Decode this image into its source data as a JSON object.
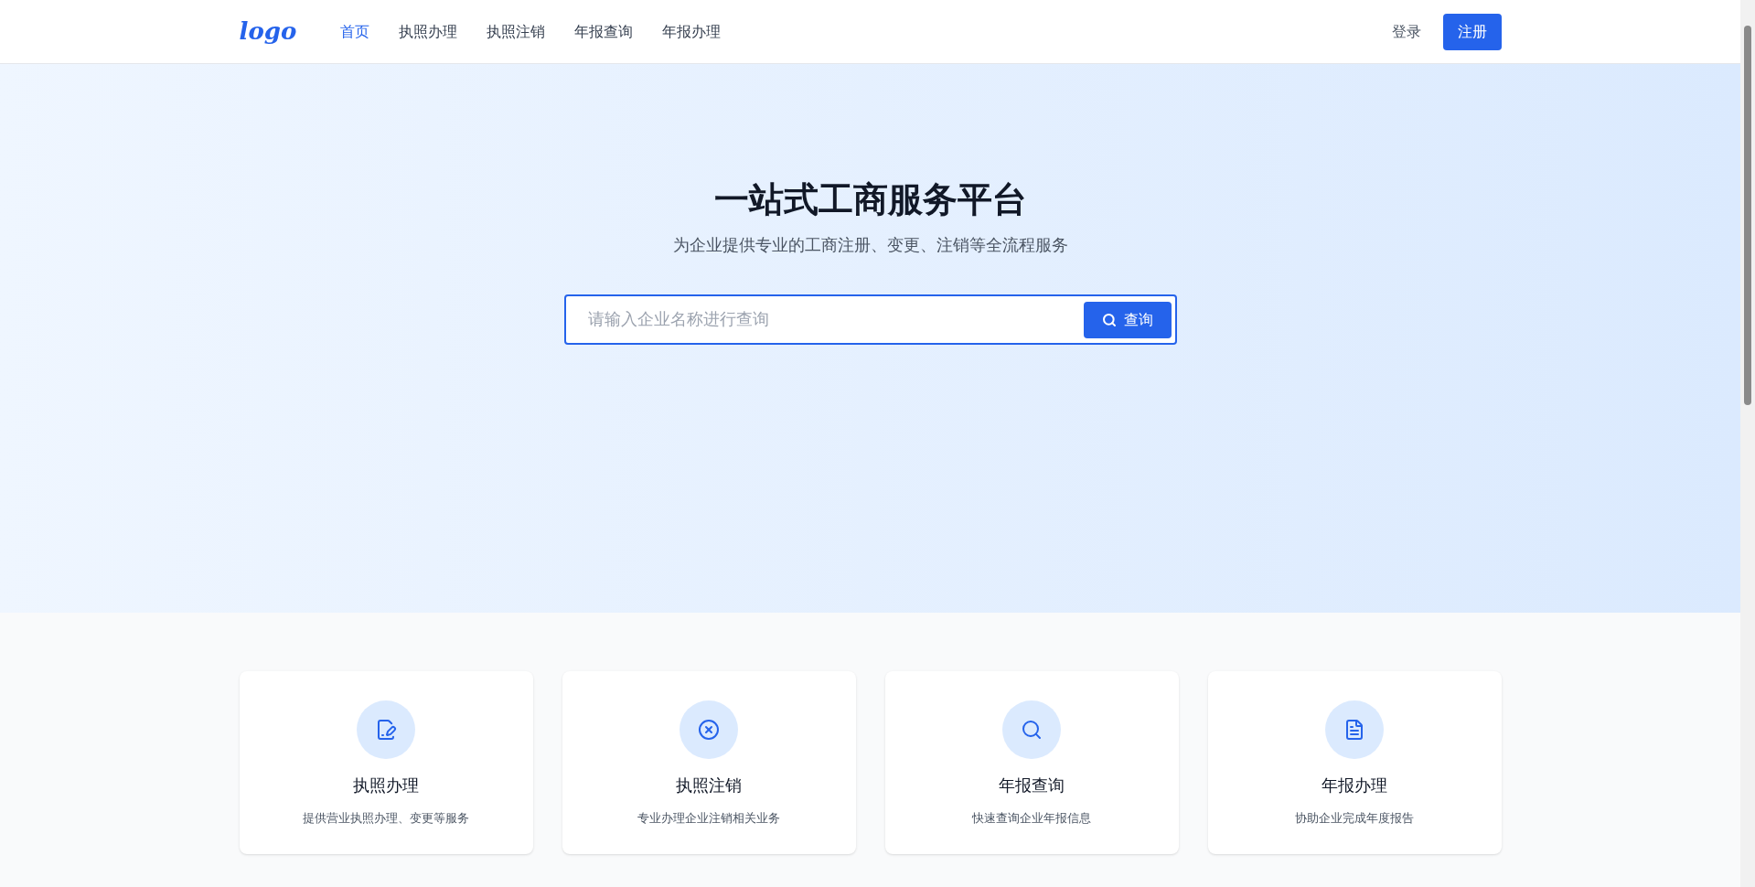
{
  "header": {
    "logo": "logo",
    "nav": [
      {
        "label": "首页",
        "selected": true
      },
      {
        "label": "执照办理",
        "selected": false
      },
      {
        "label": "执照注销",
        "selected": false
      },
      {
        "label": "年报查询",
        "selected": false
      },
      {
        "label": "年报办理",
        "selected": false
      }
    ],
    "login": "登录",
    "register": "注册"
  },
  "hero": {
    "title": "一站式工商服务平台",
    "subtitle": "为企业提供专业的工商注册、变更、注销等全流程服务",
    "search": {
      "placeholder": "请输入企业名称进行查询",
      "button": "查询"
    }
  },
  "services": [
    {
      "kind": "license",
      "title": "执照办理",
      "description": "提供营业执照办理、变更等服务"
    },
    {
      "kind": "cancel",
      "title": "执照注销",
      "description": "专业办理企业注销相关业务"
    },
    {
      "kind": "query",
      "title": "年报查询",
      "description": "快速查询企业年报信息"
    },
    {
      "kind": "report",
      "title": "年报办理",
      "description": "协助企业完成年度报告"
    }
  ]
}
